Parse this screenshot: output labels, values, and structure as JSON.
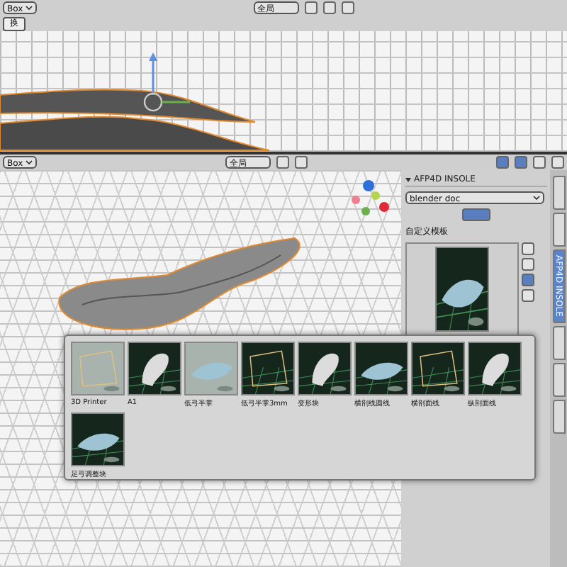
{
  "top_view": {
    "mode_dropdown": "Box",
    "scope_dropdown": "全局",
    "toggle_button": "换"
  },
  "bottom_view": {
    "mode_dropdown": "Box",
    "scope_dropdown": "全局"
  },
  "panel": {
    "title": "AFP4D INSOLE",
    "file_dropdown": "blender doc",
    "section_label": "自定义模板"
  },
  "side_tabs": [
    {
      "selected": false
    },
    {
      "selected": false
    },
    {
      "label": "AFP4D INSOLE",
      "selected": true
    },
    {
      "selected": false
    },
    {
      "selected": false
    },
    {
      "selected": false
    }
  ],
  "gallery": [
    {
      "label": "3D Printer"
    },
    {
      "label": "A1"
    },
    {
      "label": "低弓半掌"
    },
    {
      "label": "低弓半掌3mm"
    },
    {
      "label": "变形块"
    },
    {
      "label": "横剖线圆线"
    },
    {
      "label": "横剖面线"
    },
    {
      "label": "纵剖面线"
    },
    {
      "label": "足弓调整块"
    }
  ]
}
